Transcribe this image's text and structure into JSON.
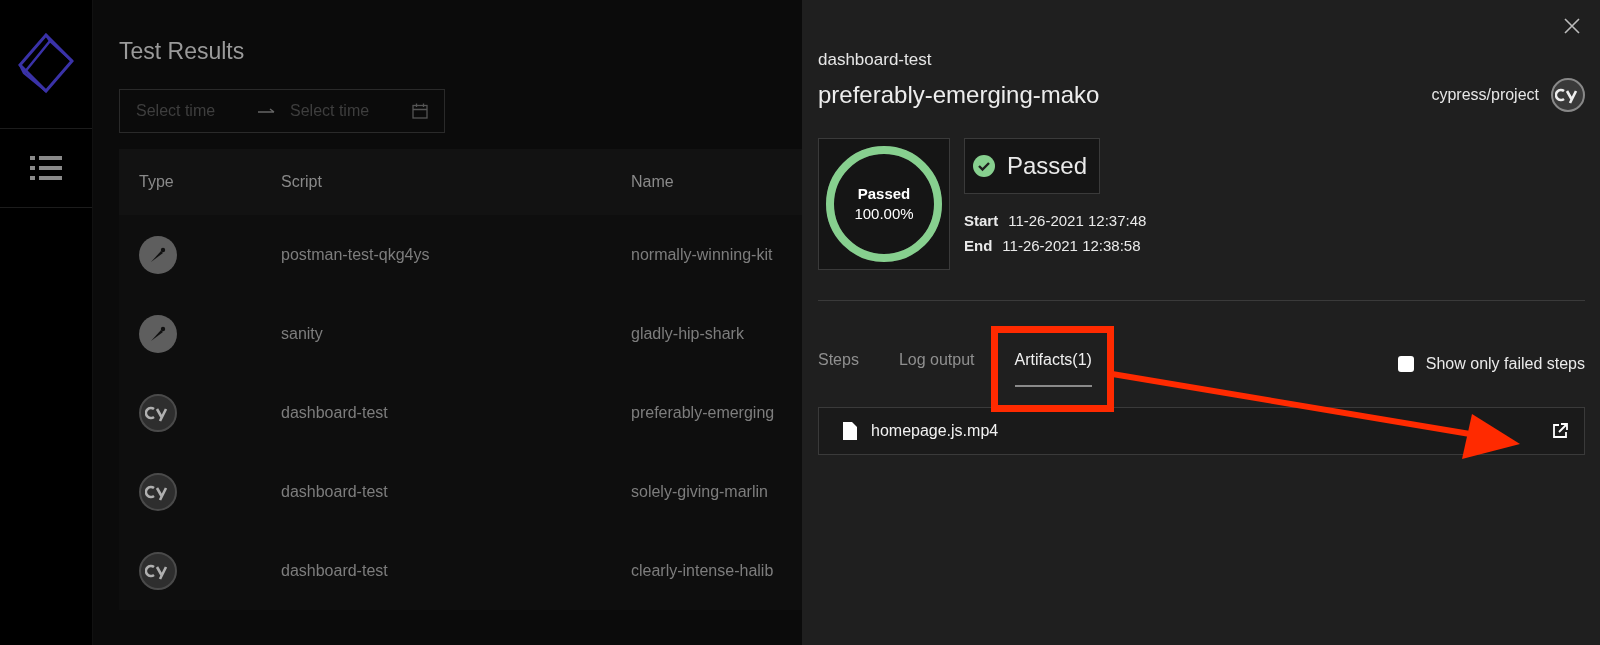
{
  "page": {
    "title": "Test Results"
  },
  "date_range": {
    "start_placeholder": "Select time",
    "end_placeholder": "Select time"
  },
  "table": {
    "columns": [
      "Type",
      "Script",
      "Name"
    ],
    "rows": [
      {
        "kind": "postman",
        "script": "postman-test-qkg4ys",
        "name": "normally-winning-kit"
      },
      {
        "kind": "postman",
        "script": "sanity",
        "name": "gladly-hip-shark"
      },
      {
        "kind": "cypress",
        "script": "dashboard-test",
        "name": "preferably-emerging"
      },
      {
        "kind": "cypress",
        "script": "dashboard-test",
        "name": "solely-giving-marlin"
      },
      {
        "kind": "cypress",
        "script": "dashboard-test",
        "name": "clearly-intense-halib"
      }
    ]
  },
  "drawer": {
    "script": "dashboard-test",
    "name": "preferably-emerging-mako",
    "project": "cypress/project",
    "result": {
      "label": "Passed",
      "percent": "100.00%",
      "level": 1
    },
    "status": {
      "label": "Passed"
    },
    "times": [
      {
        "label": "Start",
        "value": "11-26-2021 12:37:48"
      },
      {
        "label": "End",
        "value": "11-26-2021 12:38:58"
      }
    ],
    "tabs": [
      {
        "label": "Steps",
        "selected": false
      },
      {
        "label": "Log output",
        "selected": false
      },
      {
        "label": "Artifacts(1)",
        "selected": true
      }
    ],
    "failed_only": {
      "label": "Show only failed steps",
      "checked": false
    },
    "artifacts": [
      {
        "name": "homepage.js.mp4"
      }
    ]
  }
}
